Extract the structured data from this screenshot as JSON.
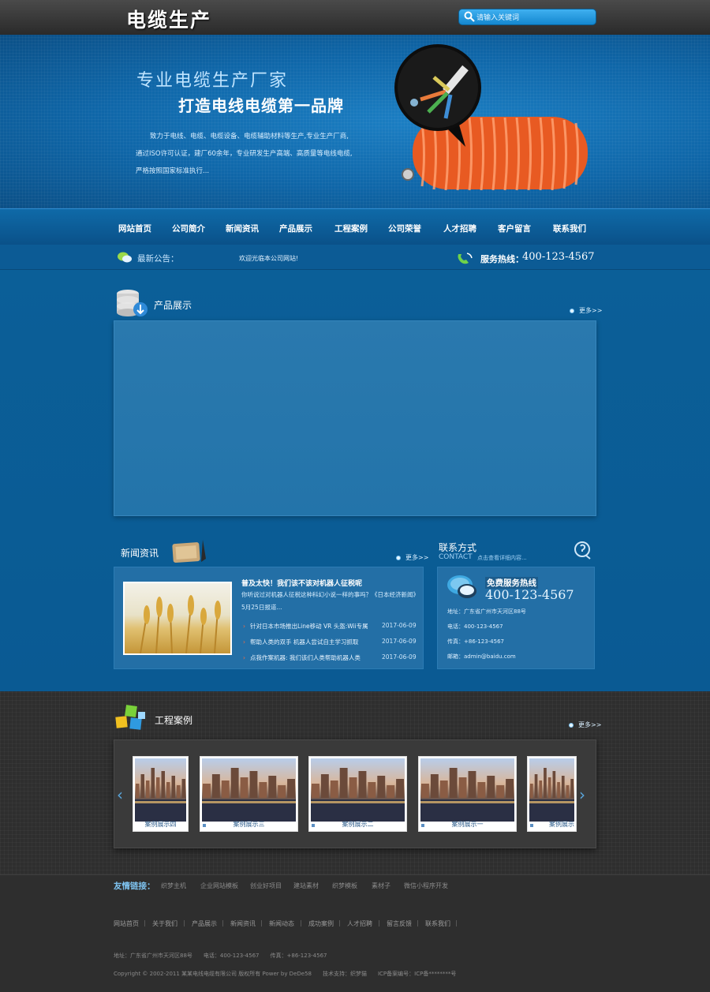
{
  "header": {
    "logo_text": "电缆生产",
    "search_placeholder": "请输入关键词"
  },
  "banner": {
    "slogan_line1": "专业电缆生产厂家",
    "slogan_line2": "打造电线电缆第一品牌",
    "description_lines": [
      "致力于电线、电缆、电缆设备、电缆辅助材料等生产,专业生产厂商,",
      "通过ISO许可认证，建厂60余年，专业研发生产高端、高质量等电线电缆,",
      "严格按照国家标准执行..."
    ]
  },
  "nav": {
    "items": [
      "网站首页",
      "公司简介",
      "新闻资讯",
      "产品展示",
      "工程案例",
      "公司荣誉",
      "人才招聘",
      "客户留言",
      "联系我们"
    ]
  },
  "notice": {
    "title": "最新公告：",
    "text": "欢迎光临本公司网站!",
    "hotline_label": "服务热线：",
    "hotline_number": "400-123-4567"
  },
  "products": {
    "title": "产品展示",
    "more": "更多>>"
  },
  "news": {
    "title": "新闻资讯",
    "more": "更多>>",
    "headline": "普及太快！我们该不该对机器人征税呢",
    "summary": "你听说过对机器人征税这种科幻小说一样的事吗？《日本经济新闻》5月25日报道...",
    "rows": [
      {
        "title": "针对日本市场推出Line移动 VR 头盔:Wii专属",
        "date": "2017-06-09"
      },
      {
        "title": "帮助人类的双手 机器人尝试自主学习抓取",
        "date": "2017-06-09"
      },
      {
        "title": "点我作案机器: 我们该们人类帮助机器人类",
        "date": "2017-06-09"
      }
    ]
  },
  "contact": {
    "title": "联系方式",
    "title_en": "CONTACT",
    "hint": "点击查看详细内容...",
    "free_label": "免费服务热线",
    "free_number": "400-123-4567",
    "lines": [
      "地址：广东省广州市天河区88号",
      "电话：400-123-4567",
      "传真：+86-123-4567",
      "邮箱：admin@baidu.com"
    ]
  },
  "cases": {
    "title": "工程案例",
    "more": "更多>>",
    "items": [
      "案例展示四",
      "案例展示三",
      "案例展示二",
      "案例展示一",
      "案例展示"
    ]
  },
  "footer": {
    "links_title": "友情链接：",
    "links": [
      "织梦主机",
      "企业网站模板",
      "创业好项目",
      "建站素材",
      "织梦模板",
      "素材子",
      "微信小程序开发"
    ],
    "nav": [
      "网站首页",
      "关于我们",
      "产品展示",
      "新闻资讯",
      "新闻动态",
      "成功案例",
      "人才招聘",
      "留言反馈",
      "联系我们"
    ],
    "address_line": "地址：广东省广州市天河区88号　　电话：400-123-4567　　传真：+86-123-4567",
    "copyright_line": "Copyright © 2002-2011 某某电线电缆有限公司 版权所有 Power by DeDe58　　技术支持：织梦猫　　ICP备案编号：ICP备********号"
  },
  "colors": {
    "brand_blue": "#0b5a8e",
    "nav_blue": "#0f6aa8",
    "dark_bg": "#2e2e2e",
    "accent_arrow": "#ff6b3a"
  }
}
